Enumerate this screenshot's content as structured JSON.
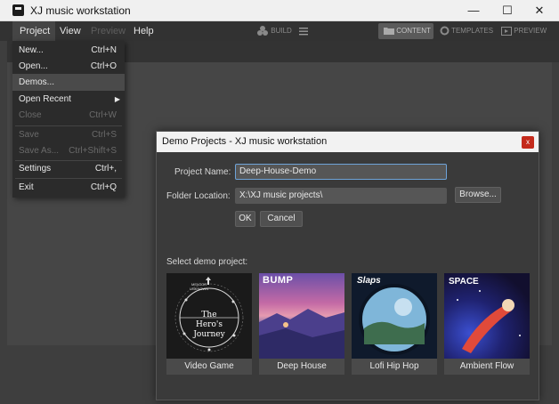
{
  "window": {
    "title": "XJ music workstation",
    "controls": [
      "—",
      "☐",
      "✕"
    ]
  },
  "menubar": {
    "items": [
      {
        "label": "Project",
        "dim": false
      },
      {
        "label": "View",
        "dim": false
      },
      {
        "label": "Preview",
        "dim": true
      },
      {
        "label": "Help",
        "dim": false
      }
    ]
  },
  "toolbar": {
    "build_label": "BUILD",
    "content_label": "CONTENT",
    "templates_label": "TEMPLATES",
    "preview_label": "PREVIEW"
  },
  "project_menu": {
    "items": [
      {
        "label": "New...",
        "shortcut": "Ctrl+N",
        "disabled": false,
        "highlighted": false
      },
      {
        "label": "Open...",
        "shortcut": "Ctrl+O",
        "disabled": false,
        "highlighted": false
      },
      {
        "label": "Demos...",
        "shortcut": "",
        "disabled": false,
        "highlighted": true
      },
      {
        "label": "Open Recent",
        "shortcut": "",
        "disabled": false,
        "highlighted": false,
        "submenu": true
      },
      {
        "label": "Close",
        "shortcut": "Ctrl+W",
        "disabled": true,
        "highlighted": false
      },
      {
        "label": "Save",
        "shortcut": "Ctrl+S",
        "disabled": true,
        "highlighted": false
      },
      {
        "label": "Save As...",
        "shortcut": "Ctrl+Shift+S",
        "disabled": true,
        "highlighted": false
      },
      {
        "label": "Settings",
        "shortcut": "Ctrl+,",
        "disabled": false,
        "highlighted": false
      },
      {
        "label": "Exit",
        "shortcut": "Ctrl+Q",
        "disabled": false,
        "highlighted": false
      }
    ]
  },
  "dialog": {
    "title": "Demo Projects - XJ music workstation",
    "close_glyph": "x",
    "project_name_label": "Project Name:",
    "project_name_value": "Deep-House-Demo",
    "folder_location_label": "Folder Location:",
    "folder_location_value": "X:\\XJ music projects\\",
    "browse_label": "Browse...",
    "ok_label": "OK",
    "cancel_label": "Cancel",
    "select_label": "Select demo project:",
    "demos": [
      {
        "caption": "Video Game",
        "art_text": [
          "The",
          "Hero's",
          "Journey"
        ],
        "art_small": [
          "MENTOR",
          "UNKNOWN"
        ]
      },
      {
        "caption": "Deep House",
        "art_text": [
          "BUMP"
        ]
      },
      {
        "caption": "Lofi Hip Hop",
        "art_text": [
          "Slaps"
        ]
      },
      {
        "caption": "Ambient Flow",
        "art_text": [
          "SPACE"
        ]
      }
    ]
  }
}
